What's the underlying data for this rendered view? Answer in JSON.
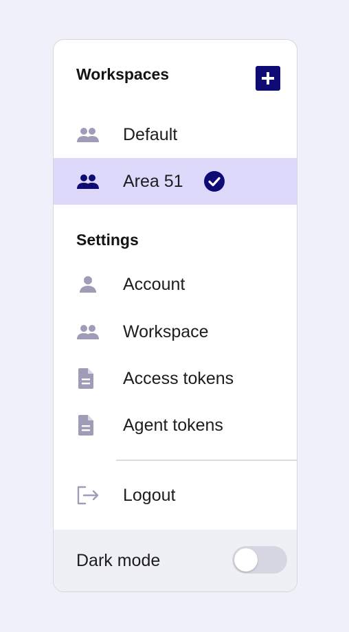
{
  "workspaces": {
    "title": "Workspaces",
    "add_button_icon": "plus-icon",
    "items": [
      {
        "label": "Default",
        "icon": "group-icon",
        "selected": false
      },
      {
        "label": "Area 51",
        "icon": "group-icon",
        "selected": true,
        "badge_icon": "check-circle-icon"
      }
    ]
  },
  "settings": {
    "title": "Settings",
    "items": [
      {
        "label": "Account",
        "icon": "person-icon"
      },
      {
        "label": "Workspace",
        "icon": "group-icon"
      },
      {
        "label": "Access tokens",
        "icon": "document-icon"
      },
      {
        "label": "Agent tokens",
        "icon": "document-icon"
      }
    ]
  },
  "logout": {
    "label": "Logout",
    "icon": "logout-icon"
  },
  "dark_mode": {
    "label": "Dark mode",
    "enabled": false
  },
  "colors": {
    "accent": "#0e0b74",
    "selected_bg": "#dcd9fb",
    "icon_muted": "#9f9cb8",
    "page_bg": "#eff0f9"
  }
}
